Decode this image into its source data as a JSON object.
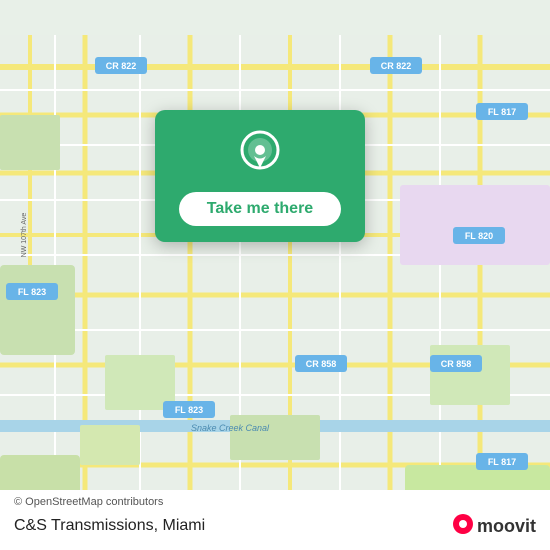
{
  "map": {
    "background_color": "#e8efe8",
    "attribution": "© OpenStreetMap contributors"
  },
  "location_card": {
    "button_label": "Take me there",
    "pin_icon": "location-pin"
  },
  "bottom_bar": {
    "place_name": "C&S Transmissions, Miami",
    "attribution": "© OpenStreetMap contributors",
    "moovit_label": "moovit"
  },
  "road_labels": [
    "CR 822",
    "CR 822",
    "FL 817",
    "FL 820",
    "FL 823",
    "FL 817",
    "CR 858",
    "CR 858",
    "FL 823",
    "Snake Creek Canal"
  ]
}
